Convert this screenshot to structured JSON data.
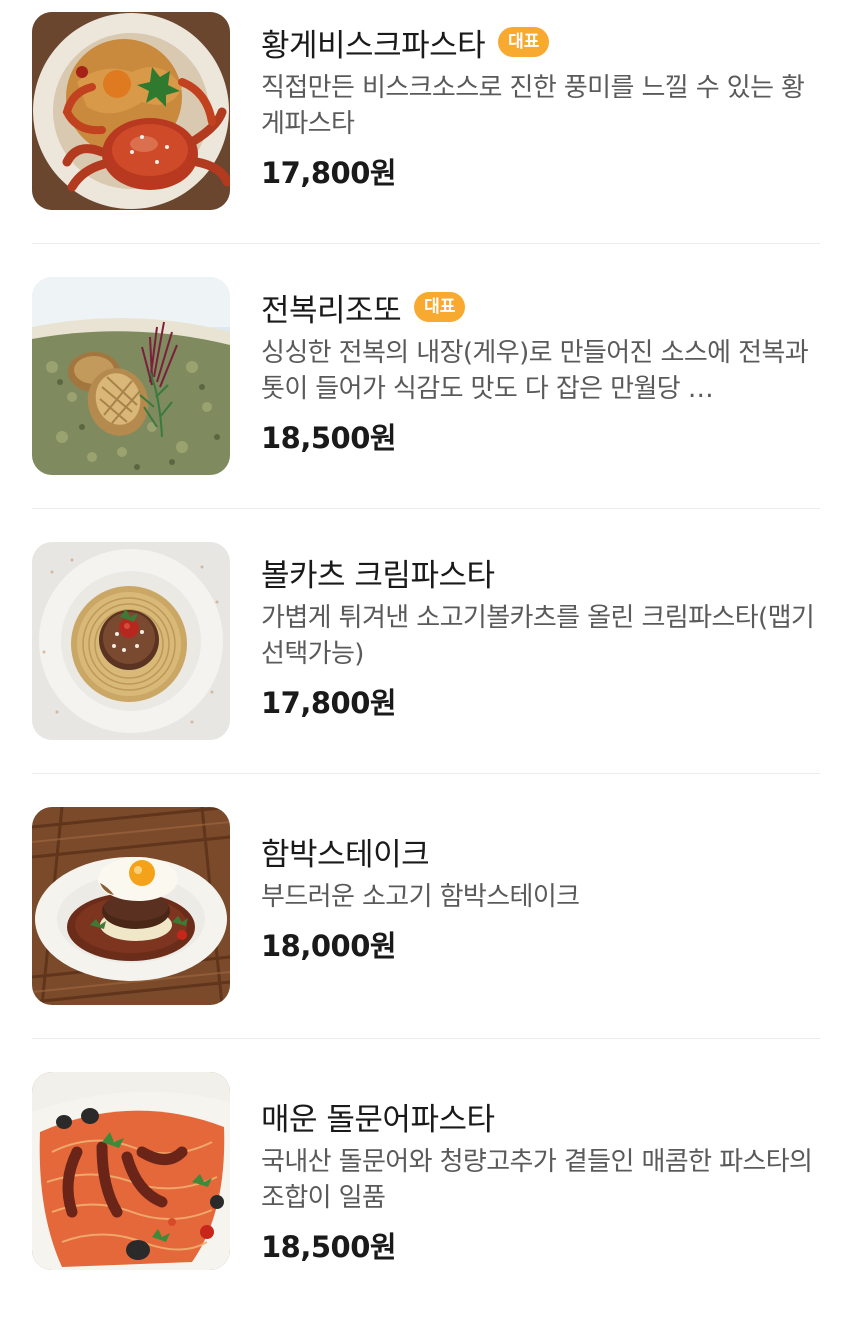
{
  "menu_items": [
    {
      "name": "황게비스크파스타",
      "badge": "대표",
      "description": "직접만든 비스크소스로 진한 풍미를 느낄 수 있는 황게파스타",
      "price": "17,800원",
      "image": "crab-bisque-pasta-photo"
    },
    {
      "name": "전복리조또",
      "badge": "대표",
      "description": "싱싱한 전복의 내장(게우)로 만들어진 소스에 전복과 톳이 들어가 식감도 맛도 다 잡은 만월당 …",
      "price": "18,500원",
      "image": "abalone-risotto-photo"
    },
    {
      "name": "볼카츠 크림파스타",
      "badge": "",
      "description": "가볍게 튀겨낸 소고기볼카츠를 올린 크림파스타(맵기선택가능)",
      "price": "17,800원",
      "image": "ball-cutlet-cream-pasta-photo"
    },
    {
      "name": "함박스테이크",
      "badge": "",
      "description": "부드러운 소고기 함박스테이크",
      "price": "18,000원",
      "image": "hamburg-steak-photo"
    },
    {
      "name": "매운 돌문어파스타",
      "badge": "",
      "description": "국내산 돌문어와 청량고추가 곁들인 매콤한 파스타의 조합이 일품",
      "price": "18,500원",
      "image": "spicy-octopus-pasta-photo"
    }
  ],
  "colors": {
    "badge": "#f7a930",
    "divider": "#ececec",
    "description": "#5a5a5a"
  }
}
